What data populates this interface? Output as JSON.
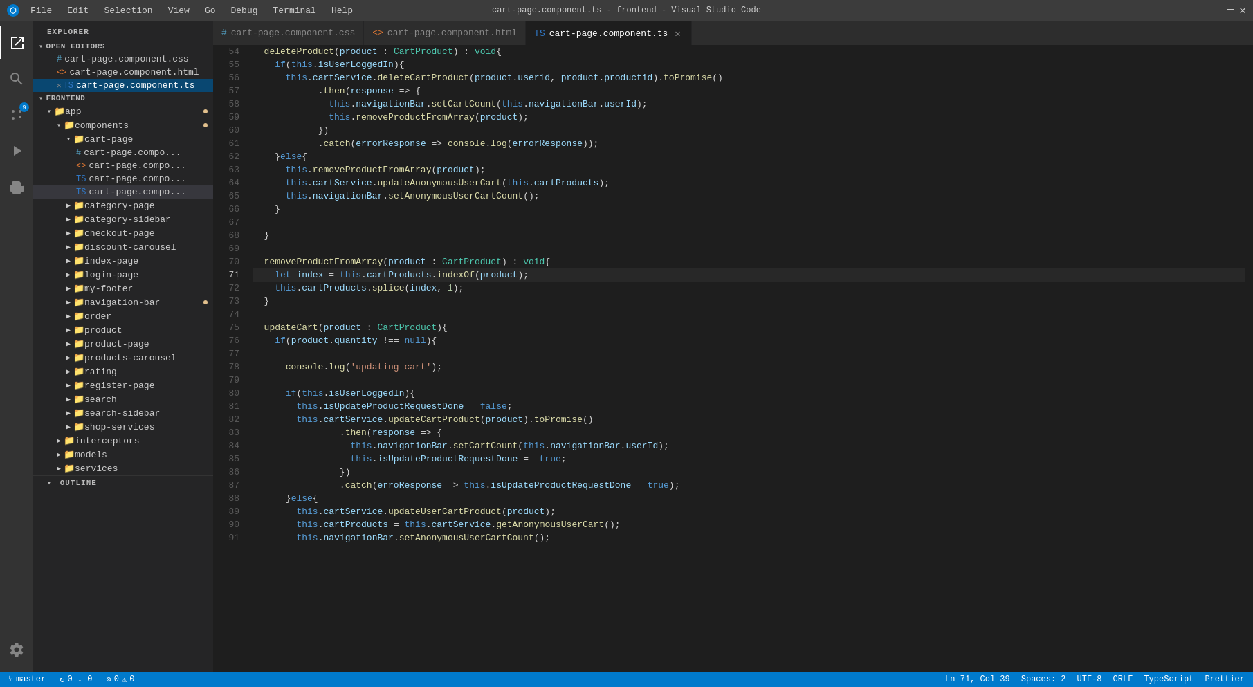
{
  "titleBar": {
    "title": "cart-page.component.ts - frontend - Visual Studio Code",
    "menus": [
      "File",
      "Edit",
      "Selection",
      "View",
      "Go",
      "Debug",
      "Terminal",
      "Help"
    ],
    "minimize": "—",
    "close": "✕"
  },
  "activityBar": {
    "items": [
      {
        "name": "explorer",
        "icon": "📋",
        "active": true
      },
      {
        "name": "search",
        "icon": "🔍",
        "active": false
      },
      {
        "name": "source-control",
        "icon": "⑂",
        "active": false,
        "badge": "9"
      },
      {
        "name": "run",
        "icon": "▷",
        "active": false
      },
      {
        "name": "extensions",
        "icon": "⊞",
        "active": false
      }
    ],
    "bottom": [
      {
        "name": "settings",
        "icon": "⚙"
      }
    ]
  },
  "sidebar": {
    "title": "EXPLORER",
    "sections": {
      "openEditors": {
        "label": "OPEN EDITORS",
        "files": [
          {
            "name": "cart-page.component.css",
            "icon": "#",
            "iconColor": "#519aba"
          },
          {
            "name": "cart-page.component.html",
            "icon": "<>",
            "iconColor": "#e37933"
          },
          {
            "name": "cart-page.component.ts",
            "icon": "TS",
            "iconColor": "#3178c6",
            "active": true
          }
        ]
      },
      "frontend": {
        "label": "FRONTEND",
        "folders": [
          {
            "name": "app",
            "indent": 1,
            "hasDot": true,
            "children": [
              {
                "name": "components",
                "indent": 2,
                "hasDot": true,
                "children": [
                  {
                    "name": "cart-page",
                    "indent": 3,
                    "children": [
                      {
                        "name": "cart-page.compo...",
                        "icon": "#",
                        "indent": 4
                      },
                      {
                        "name": "cart-page.compo...",
                        "icon": "<>",
                        "indent": 4
                      },
                      {
                        "name": "cart-page.compo...",
                        "icon": "TS",
                        "indent": 4
                      },
                      {
                        "name": "cart-page.compo...",
                        "icon": "TS",
                        "indent": 4,
                        "active": true
                      }
                    ]
                  },
                  {
                    "name": "category-page",
                    "indent": 3,
                    "collapsed": true
                  },
                  {
                    "name": "category-sidebar",
                    "indent": 3,
                    "collapsed": true
                  },
                  {
                    "name": "checkout-page",
                    "indent": 3,
                    "collapsed": true
                  },
                  {
                    "name": "discount-carousel",
                    "indent": 3,
                    "collapsed": true
                  },
                  {
                    "name": "index-page",
                    "indent": 3,
                    "collapsed": true
                  },
                  {
                    "name": "login-page",
                    "indent": 3,
                    "collapsed": true
                  },
                  {
                    "name": "my-footer",
                    "indent": 3,
                    "collapsed": true
                  },
                  {
                    "name": "navigation-bar",
                    "indent": 3,
                    "collapsed": true,
                    "hasDot": true
                  },
                  {
                    "name": "order",
                    "indent": 3,
                    "collapsed": true
                  },
                  {
                    "name": "product",
                    "indent": 3,
                    "collapsed": true
                  },
                  {
                    "name": "product-page",
                    "indent": 3,
                    "collapsed": true
                  },
                  {
                    "name": "products-carousel",
                    "indent": 3,
                    "collapsed": true
                  },
                  {
                    "name": "rating",
                    "indent": 3,
                    "collapsed": true
                  },
                  {
                    "name": "register-page",
                    "indent": 3,
                    "collapsed": true
                  },
                  {
                    "name": "search",
                    "indent": 3,
                    "collapsed": true
                  },
                  {
                    "name": "search-sidebar",
                    "indent": 3,
                    "collapsed": true
                  },
                  {
                    "name": "shop-services",
                    "indent": 3,
                    "collapsed": true
                  }
                ]
              },
              {
                "name": "interceptors",
                "indent": 2,
                "collapsed": true
              },
              {
                "name": "models",
                "indent": 2,
                "collapsed": true
              },
              {
                "name": "services",
                "indent": 2,
                "collapsed": true
              }
            ]
          }
        ]
      }
    },
    "outline": "OUTLINE"
  },
  "tabs": [
    {
      "label": "cart-page.component.css",
      "icon": "#",
      "iconColor": "#519aba",
      "active": false,
      "closable": false
    },
    {
      "label": "cart-page.component.html",
      "icon": "<>",
      "iconColor": "#e37933",
      "active": false,
      "closable": false
    },
    {
      "label": "cart-page.component.ts",
      "icon": "TS",
      "iconColor": "#3178c6",
      "active": true,
      "closable": true
    }
  ],
  "codeLines": [
    {
      "num": 54,
      "content": "  deleteProduct(product : CartProduct) : void{"
    },
    {
      "num": 55,
      "content": "    if(this.isUserLoggedIn){"
    },
    {
      "num": 56,
      "content": "      this.cartService.deleteCartProduct(product.userid, product.productid).toPromise()"
    },
    {
      "num": 57,
      "content": "            .then(response => {"
    },
    {
      "num": 58,
      "content": "              this.navigationBar.setCartCount(this.navigationBar.userId);"
    },
    {
      "num": 59,
      "content": "              this.removeProductFromArray(product);"
    },
    {
      "num": 60,
      "content": "            })"
    },
    {
      "num": 61,
      "content": "            .catch(errorResponse => console.log(errorResponse));"
    },
    {
      "num": 62,
      "content": "    }else{"
    },
    {
      "num": 63,
      "content": "      this.removeProductFromArray(product);"
    },
    {
      "num": 64,
      "content": "      this.cartService.updateAnonymousUserCart(this.cartProducts);"
    },
    {
      "num": 65,
      "content": "      this.navigationBar.setAnonymousUserCartCount();"
    },
    {
      "num": 66,
      "content": "    }"
    },
    {
      "num": 67,
      "content": ""
    },
    {
      "num": 68,
      "content": "  }"
    },
    {
      "num": 69,
      "content": ""
    },
    {
      "num": 70,
      "content": "  removeProductFromArray(product : CartProduct) : void{"
    },
    {
      "num": 71,
      "content": "    let index = this.cartProducts.indexOf(product);",
      "active": true
    },
    {
      "num": 72,
      "content": "    this.cartProducts.splice(index, 1);"
    },
    {
      "num": 73,
      "content": "  }"
    },
    {
      "num": 74,
      "content": ""
    },
    {
      "num": 75,
      "content": "  updateCart(product : CartProduct){"
    },
    {
      "num": 76,
      "content": "    if(product.quantity !== null){"
    },
    {
      "num": 77,
      "content": ""
    },
    {
      "num": 78,
      "content": "      console.log('updating cart');"
    },
    {
      "num": 79,
      "content": ""
    },
    {
      "num": 80,
      "content": "      if(this.isUserLoggedIn){"
    },
    {
      "num": 81,
      "content": "        this.isUpdateProductRequestDone = false;"
    },
    {
      "num": 82,
      "content": "        this.cartService.updateCartProduct(product).toPromise()"
    },
    {
      "num": 83,
      "content": "                .then(response => {"
    },
    {
      "num": 84,
      "content": "                  this.navigationBar.setCartCount(this.navigationBar.userId);"
    },
    {
      "num": 85,
      "content": "                  this.isUpdateProductRequestDone =  true;"
    },
    {
      "num": 86,
      "content": "                })"
    },
    {
      "num": 87,
      "content": "                .catch(erroResponse => this.isUpdateProductRequestDone = true);"
    },
    {
      "num": 88,
      "content": "      }else{"
    },
    {
      "num": 89,
      "content": "        this.cartService.updateUserCartProduct(product);"
    },
    {
      "num": 90,
      "content": "        this.cartProducts = this.cartService.getAnonymousUserCart();"
    },
    {
      "num": 91,
      "content": "        this.navigationBar.setAnonymousUserCartCount();"
    }
  ],
  "statusBar": {
    "branch": "master",
    "sync": "↻ 0 ↓ 0",
    "errors": "⊗ 0",
    "warnings": "⚠ 0",
    "rightItems": [
      "Ln 71, Col 39",
      "Spaces: 2",
      "UTF-8",
      "CRLF",
      "TypeScript",
      "Prettier"
    ]
  }
}
